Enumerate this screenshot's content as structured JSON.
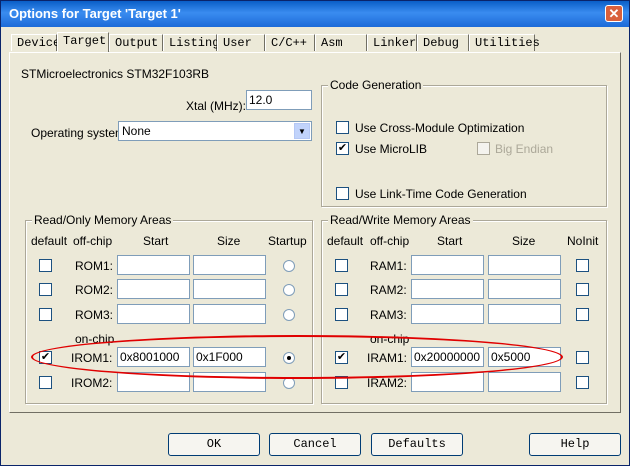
{
  "window": {
    "title": "Options for Target 'Target 1'",
    "close_glyph": "✕"
  },
  "tabs": [
    "Device",
    "Target",
    "Output",
    "Listing",
    "User",
    "C/C++",
    "Asm",
    "Linker",
    "Debug",
    "Utilities"
  ],
  "device_name": "STMicroelectronics STM32F103RB",
  "xtal": {
    "label": "Xtal (MHz):",
    "value": "12.0"
  },
  "os": {
    "label": "Operating system:",
    "value": "None"
  },
  "code_gen": {
    "title": "Code Generation",
    "cross_module": {
      "label": "Use Cross-Module Optimization",
      "checked": false
    },
    "microlib": {
      "label": "Use MicroLIB",
      "checked": true
    },
    "big_endian": {
      "label": "Big Endian",
      "checked": false,
      "enabled": false
    },
    "ltcg": {
      "label": "Use Link-Time Code Generation",
      "checked": false
    }
  },
  "rom_areas": {
    "title": "Read/Only Memory Areas",
    "headers": {
      "default": "default",
      "offchip": "off-chip",
      "start": "Start",
      "size": "Size",
      "startup": "Startup"
    },
    "onchip_label": "on-chip",
    "rows": [
      {
        "name": "ROM1:",
        "default": false,
        "start": "",
        "size": "",
        "startup": false
      },
      {
        "name": "ROM2:",
        "default": false,
        "start": "",
        "size": "",
        "startup": false
      },
      {
        "name": "ROM3:",
        "default": false,
        "start": "",
        "size": "",
        "startup": false
      },
      {
        "name": "IROM1:",
        "default": true,
        "start": "0x8001000",
        "size": "0x1F000",
        "startup": true
      },
      {
        "name": "IROM2:",
        "default": false,
        "start": "",
        "size": "",
        "startup": false
      }
    ]
  },
  "ram_areas": {
    "title": "Read/Write Memory Areas",
    "headers": {
      "default": "default",
      "offchip": "off-chip",
      "start": "Start",
      "size": "Size",
      "noinit": "NoInit"
    },
    "onchip_label": "on-chip",
    "rows": [
      {
        "name": "RAM1:",
        "default": false,
        "start": "",
        "size": "",
        "noinit": false
      },
      {
        "name": "RAM2:",
        "default": false,
        "start": "",
        "size": "",
        "noinit": false
      },
      {
        "name": "RAM3:",
        "default": false,
        "start": "",
        "size": "",
        "noinit": false
      },
      {
        "name": "IRAM1:",
        "default": true,
        "start": "0x20000000",
        "size": "0x5000",
        "noinit": false
      },
      {
        "name": "IRAM2:",
        "default": false,
        "start": "",
        "size": "",
        "noinit": false
      }
    ]
  },
  "buttons": {
    "ok": "OK",
    "cancel": "Cancel",
    "defaults": "Defaults",
    "help": "Help"
  },
  "colors": {
    "title_bar": "#0a5ec7",
    "dialog_bg": "#ece9d8",
    "annotation": "#e00000"
  }
}
